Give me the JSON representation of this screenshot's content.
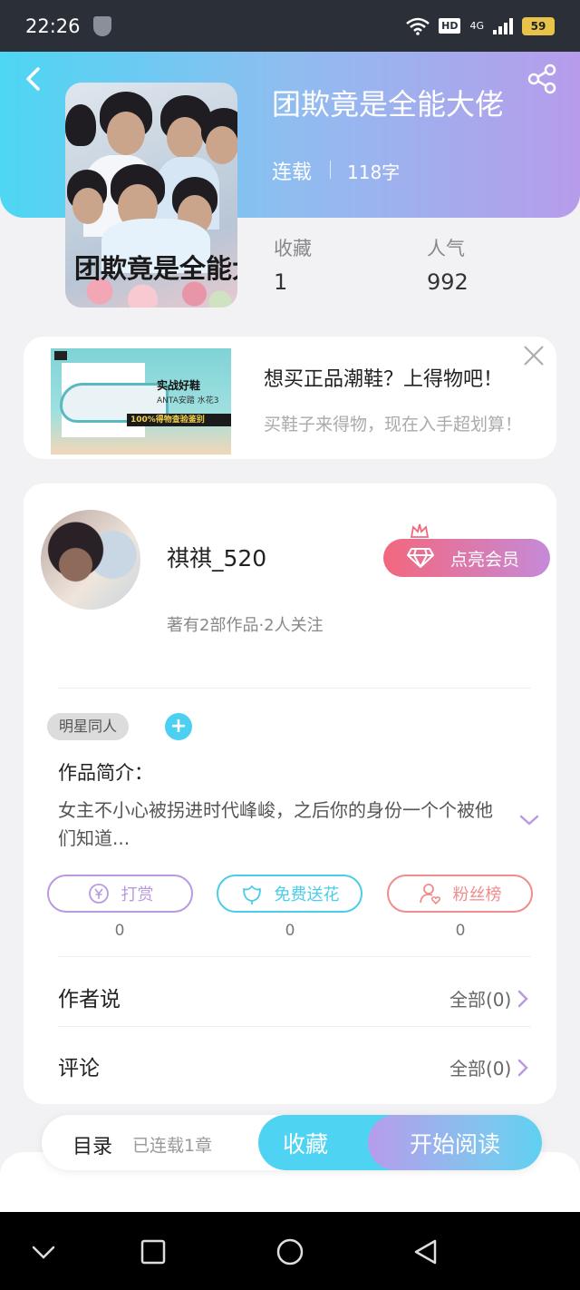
{
  "status_bar": {
    "time": "22:26",
    "hd": "HD",
    "network": "4G",
    "battery": "59"
  },
  "book": {
    "title": "团欺竟是全能大佬",
    "cover_text": "团欺竟是全能大",
    "status": "连载",
    "word_count": "118字",
    "stats": [
      {
        "label": "收藏",
        "value": "1"
      },
      {
        "label": "人气",
        "value": "992"
      }
    ]
  },
  "ad": {
    "title": "想买正品潮鞋？上得物吧！",
    "desc": "买鞋子来得物，现在入手超划算！",
    "img_title": "实战好鞋",
    "img_sub": "ANTA安踏 水花3",
    "img_band": "100%得物查验鉴别"
  },
  "author": {
    "name": "祺祺_520",
    "meta": "著有2部作品·2人关注",
    "vip_label": "点亮会员"
  },
  "tags": [
    "明星同人"
  ],
  "tag_add": "+",
  "intro": {
    "label": "作品简介：",
    "text": "女主不小心被拐进时代峰峻，之后你的身份一个个被他们知道..."
  },
  "actions": [
    {
      "label": "打赏",
      "count": "0",
      "color": "#b99ae0"
    },
    {
      "label": "免费送花",
      "count": "0",
      "color": "#4bcde8"
    },
    {
      "label": "粉丝榜",
      "count": "0",
      "color": "#f08c8c"
    }
  ],
  "rows": [
    {
      "label": "作者说",
      "right": "全部(0)"
    },
    {
      "label": "评论",
      "right": "全部(0)"
    }
  ],
  "bottom": {
    "toc": "目录",
    "toc_sub": "已连载1章",
    "favorite": "收藏",
    "read": "开始阅读"
  },
  "colors": {
    "accent_cyan": "#4fd3f3",
    "accent_purple": "#b79ceb",
    "vip_pink": "#f3677d"
  }
}
